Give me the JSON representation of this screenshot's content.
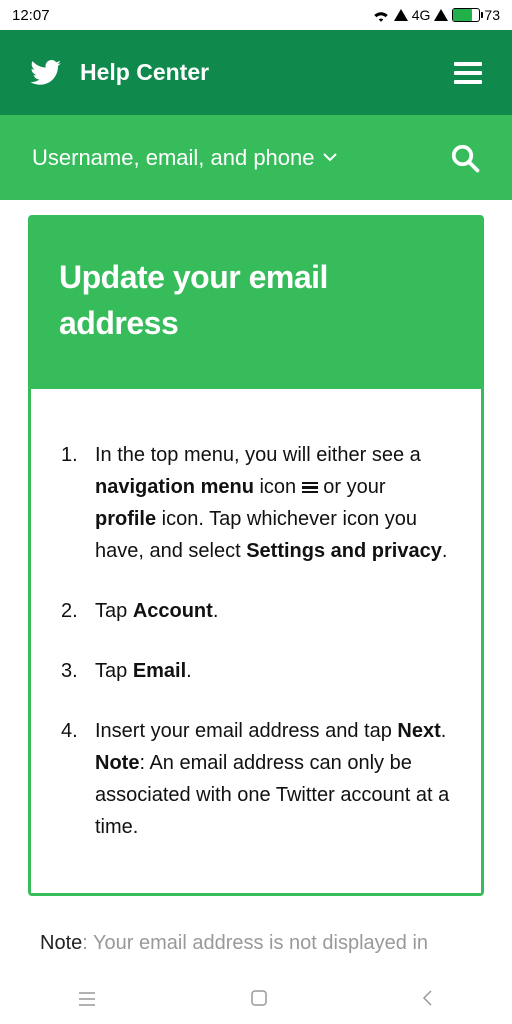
{
  "status": {
    "time": "12:07",
    "network": "4G",
    "battery": "73"
  },
  "header": {
    "title": "Help Center"
  },
  "subnav": {
    "label": "Username, email, and phone"
  },
  "card": {
    "title": "Update your email address"
  },
  "steps": {
    "s1a": "In the top menu, you will either see a ",
    "s1b": "navigation menu",
    "s1c": " icon ",
    "s1d": " or your ",
    "s1e": "profile",
    "s1f": " icon. Tap whichever icon you have, and select ",
    "s1g": "Settings and privacy",
    "s1h": ".",
    "s2a": "Tap ",
    "s2b": "Account",
    "s2c": ".",
    "s3a": "Tap ",
    "s3b": "Email",
    "s3c": ".",
    "s4a": "Insert your email address and tap ",
    "s4b": "Next",
    "s4c": ".",
    "s4d": "Note",
    "s4e": ": An email address can only be associated with one Twitter account at a time."
  },
  "footnote": {
    "label": "Note",
    "text": ": Your email address is not displayed in"
  }
}
